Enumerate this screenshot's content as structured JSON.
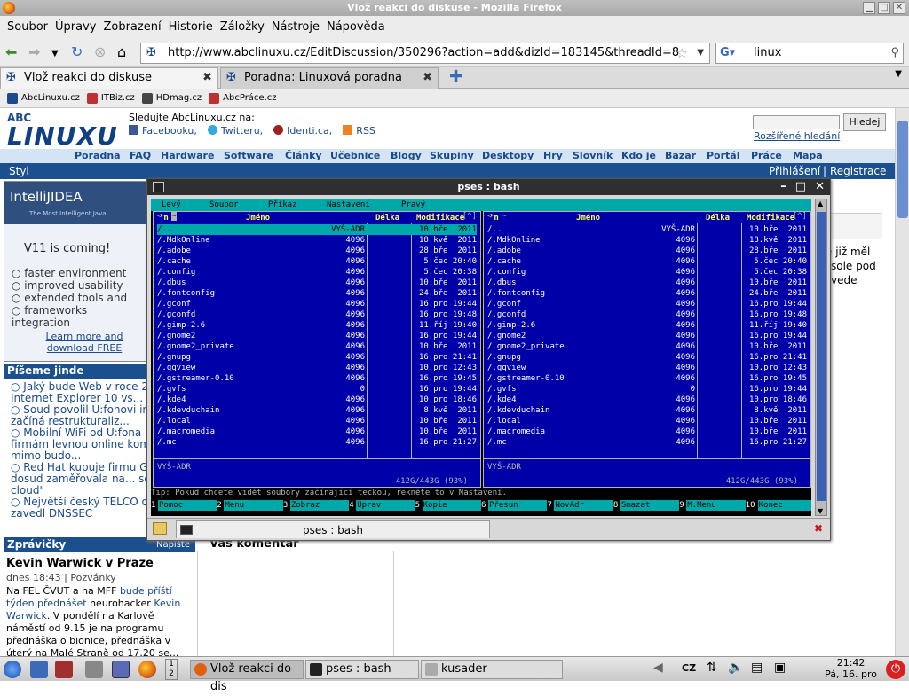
{
  "window": {
    "title": "Vlož reakci do diskuse - Mozilla Firefox"
  },
  "menu": [
    "Soubor",
    "Úpravy",
    "Zobrazení",
    "Historie",
    "Záložky",
    "Nástroje",
    "Nápověda"
  ],
  "address": {
    "url": "http://www.abclinuxu.cz/EditDiscussion/350296?action=add&dizId=183145&threadId=8"
  },
  "search": {
    "value": "linux"
  },
  "tabs": [
    {
      "label": "Vlož reakci do diskuse"
    },
    {
      "label": "Poradna: Linuxová poradna"
    }
  ],
  "bookmarks": [
    "AbcLinuxu.cz",
    "ITBiz.cz",
    "HDmag.cz",
    "AbcPráce.cz"
  ],
  "site": {
    "logo_small": "ABC",
    "logo_big": "LINUXU",
    "follow": "Sledujte AbcLinuxu.cz na:",
    "follow_links": [
      "Facebooku,",
      "Twitteru,",
      "Identi.ca,",
      "RSS"
    ],
    "search_button": "Hledej",
    "advanced_search": "Rozšířené hledání",
    "nav": [
      "Poradna",
      "FAQ",
      "Hardware",
      "Software",
      "Články",
      "Učebnice",
      "Blogy",
      "Skupiny",
      "Desktopy",
      "Hry",
      "Slovník",
      "Kdo je",
      "Bazar",
      "Portál",
      "Práce",
      "Mapa"
    ],
    "style": "Styl",
    "login": "Přihlášení",
    "separator": "|",
    "register": "Registrace",
    "ad": {
      "brand": "IntelliJIDEA",
      "slogan": "The Most Intelligent Java",
      "headline": "V11 is coming!",
      "bullets": [
        "faster environment",
        "improved usability",
        "extended tools and",
        "frameworks integration"
      ],
      "more": "Learn more and download FREE"
    },
    "piseme_head": "Píšeme jinde",
    "piseme": [
      "Jaký bude Web v roce 2020? Internet Explorer 10 vs...",
      "Soud povolil U:fonovi in... ten začíná restrukturaliz...",
      "Mobilní WiFi od U:fona n... firmám levnou online komunikaci i mimo budo...",
      "Red Hat kupuje firmu Gl... se dosud zaměřovala na... source cloud\"",
      "Největší český TELCO o... zavedl DNSSEC"
    ],
    "zpravicky_head": "Zprávičky",
    "napiste": "Napište",
    "news": {
      "title": "Kevin Warwick v Praze",
      "date": "dnes 18:43 | Pozvánky",
      "text1": "Na FEL ČVUT a na MFF ",
      "link1": "bude příští týden přednášet",
      "text2": " neurohacker ",
      "link2": "Kevin Warwick",
      "text3": ". V pondělí na Karlově náměstí od 9.15 je na programu přednáška o bionice, přednáška v úterý na Malé Straně od 17.20 se..."
    },
    "right_frag": [
      "e již měl",
      "sole pod",
      "vede"
    ],
    "comment_head": "Váš komentář"
  },
  "terminal": {
    "title": "pses : bash",
    "mc_menu": [
      "Levý",
      "Soubor",
      "Příkaz",
      "Nastavení",
      "Pravý"
    ],
    "col_name": "Jméno",
    "col_size": "Délka",
    "col_date": "Modifikace",
    "sort": "'n",
    "files": [
      {
        "n": "/..",
        "s": "VYŠ-ADR",
        "d": "10.bře  2011"
      },
      {
        "n": "/.MdkOnline",
        "s": "4096",
        "d": "18.kvě  2011"
      },
      {
        "n": "/.adobe",
        "s": "4096",
        "d": "28.bře  2011"
      },
      {
        "n": "/.cache",
        "s": "4096",
        "d": " 5.čec 20:40"
      },
      {
        "n": "/.config",
        "s": "4096",
        "d": " 5.čec 20:38"
      },
      {
        "n": "/.dbus",
        "s": "4096",
        "d": "10.bře  2011"
      },
      {
        "n": "/.fontconfig",
        "s": "4096",
        "d": "24.bře  2011"
      },
      {
        "n": "/.gconf",
        "s": "4096",
        "d": "16.pro 19:44"
      },
      {
        "n": "/.gconfd",
        "s": "4096",
        "d": "16.pro 19:48"
      },
      {
        "n": "/.gimp-2.6",
        "s": "4096",
        "d": "11.říj 19:40"
      },
      {
        "n": "/.gnome2",
        "s": "4096",
        "d": "16.pro 19:44"
      },
      {
        "n": "/.gnome2_private",
        "s": "4096",
        "d": "10.bře  2011"
      },
      {
        "n": "/.gnupg",
        "s": "4096",
        "d": "16.pro 21:41"
      },
      {
        "n": "/.gqview",
        "s": "4096",
        "d": "10.pro 12:43"
      },
      {
        "n": "/.gstreamer-0.10",
        "s": "4096",
        "d": "16.pro 19:45"
      },
      {
        "n": "/.gvfs",
        "s": "0",
        "d": "16.pro 19:44"
      },
      {
        "n": "/.kde4",
        "s": "4096",
        "d": "10.pro 18:46"
      },
      {
        "n": "/.kdevduchain",
        "s": "4096",
        "d": " 8.kvě  2011"
      },
      {
        "n": "/.local",
        "s": "4096",
        "d": "10.bře  2011"
      },
      {
        "n": "/.macromedia",
        "s": "4096",
        "d": "10.bře  2011"
      },
      {
        "n": "/.mc",
        "s": "4096",
        "d": "16.pro 21:27"
      }
    ],
    "status_left": "VYŠ-ADR",
    "status_right": "VYŠ-ADR",
    "disk_left": "412G/443G (93%)",
    "disk_right": "412G/443G (93%)",
    "hint": "Tip: Pokud chcete vidět soubory začínající tečkou, řekněte to v Nastavení.",
    "fkeys": [
      {
        "k": "1",
        "l": "Pomoc"
      },
      {
        "k": "2",
        "l": "Menu"
      },
      {
        "k": "3",
        "l": "Zobraz"
      },
      {
        "k": "4",
        "l": "Úprav"
      },
      {
        "k": "5",
        "l": "Kopie"
      },
      {
        "k": "6",
        "l": "Přesun"
      },
      {
        "k": "7",
        "l": "NovAdr"
      },
      {
        "k": "8",
        "l": "Smazat"
      },
      {
        "k": "9",
        "l": "M.Menu"
      },
      {
        "k": "10",
        "l": "Konec"
      }
    ],
    "tab_label": "pses : bash",
    "corner_left": "[^]",
    "corner_right": "[^]"
  },
  "taskbar": {
    "tasks": [
      "Vlož reakci do dis",
      "pses : bash",
      "kusader"
    ],
    "lang": "CZ",
    "time": "21:42",
    "date": "Pá, 16. pro",
    "pager": [
      "1",
      "2"
    ]
  }
}
